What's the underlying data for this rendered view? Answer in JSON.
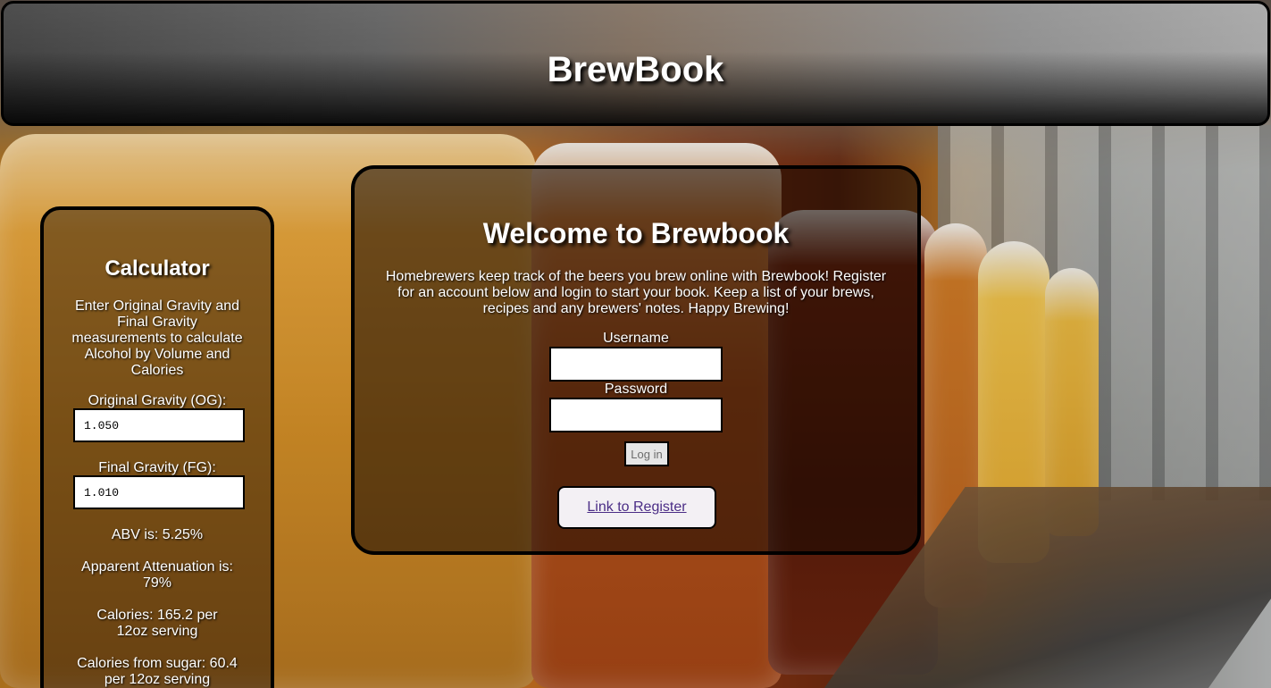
{
  "header": {
    "title": "BrewBook"
  },
  "calculator": {
    "title": "Calculator",
    "description": "Enter Original Gravity and Final Gravity measurements to calculate Alcohol by Volume and Calories",
    "og_label": "Original Gravity (OG):",
    "og_value": "1.050",
    "fg_label": "Final Gravity (FG):",
    "fg_value": "1.010",
    "abv_text": "ABV is: 5.25%",
    "attenuation_text": "Apparent Attenuation is: 79%",
    "calories_text": "Calories: 165.2 per 12oz serving",
    "calories_sugar_text": "Calories from sugar: 60.4 per 12oz serving"
  },
  "welcome": {
    "title": "Welcome to Brewbook",
    "intro": "Homebrewers keep track of the beers you brew online with Brewbook! Register for an account below and login to start your book. Keep a list of your brews, recipes and any brewers' notes. Happy Brewing!",
    "username_label": "Username",
    "username_value": "",
    "password_label": "Password",
    "password_value": "",
    "login_label": "Log in",
    "register_link": "Link to Register"
  }
}
